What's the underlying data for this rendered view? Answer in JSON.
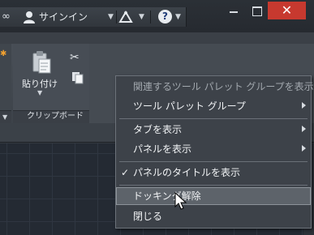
{
  "titlebar": {
    "signin_label": "サインイン",
    "window_buttons": {
      "minimize": "minimize-icon",
      "maximize": "maximize-icon",
      "close": "✕"
    },
    "help_label": "?"
  },
  "ribbon": {
    "paste_label": "貼り付け",
    "clipboard_panel_label": "クリップボード"
  },
  "menu": {
    "items": [
      {
        "label": "関連するツール パレット グループを表示",
        "disabled": true
      },
      {
        "label": "ツール パレット グループ",
        "submenu": true
      },
      {
        "label": "タブを表示",
        "submenu": true
      },
      {
        "label": "パネルを表示",
        "submenu": true
      },
      {
        "label": "パネルのタイトルを表示",
        "checked": true,
        "check_glyph": "✓"
      },
      {
        "label": "ドッキング解除",
        "hover": true
      },
      {
        "label": "閉じる"
      }
    ]
  },
  "colors": {
    "close_button": "#c7392f",
    "menu_bg": "#3d4249",
    "menu_hover": "#5d636a"
  }
}
